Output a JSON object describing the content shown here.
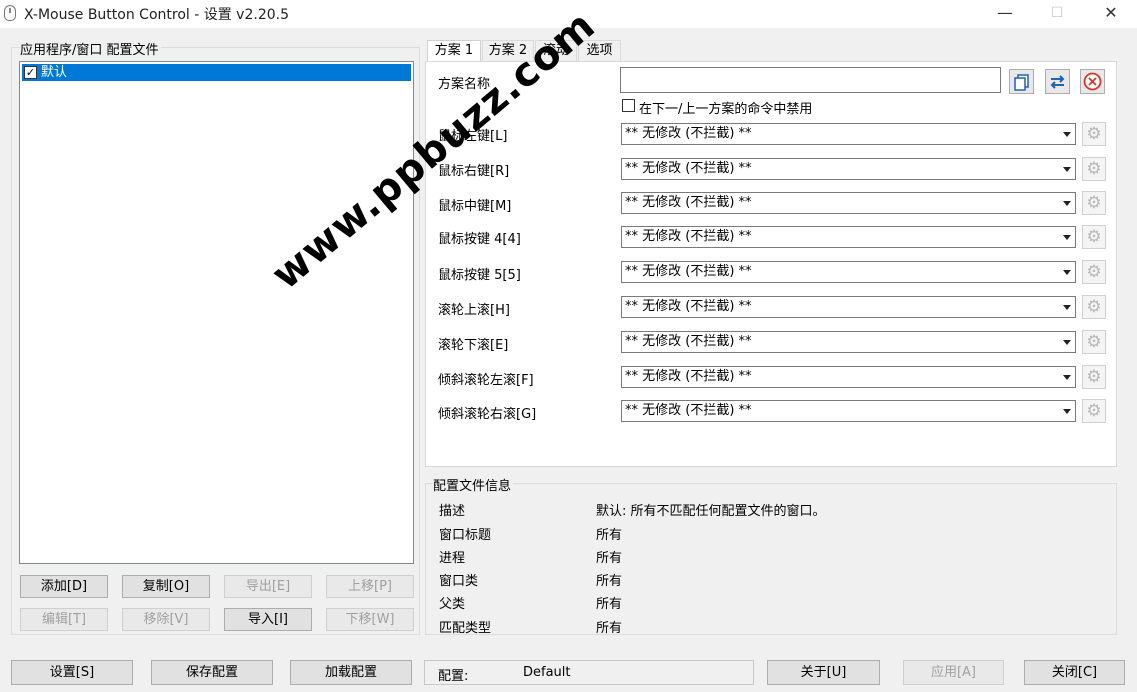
{
  "window": {
    "title": "X-Mouse Button Control - 设置 v2.20.5",
    "minimize_icon": "—",
    "maximize_icon": "☐",
    "close_icon": "✕"
  },
  "left_panel": {
    "group_label": "应用程序/窗口 配置文件",
    "list_items": [
      {
        "label": "默认",
        "checked": true,
        "check_glyph": "✓"
      }
    ],
    "buttons_row1": [
      {
        "label": "添加[D]",
        "enabled": true
      },
      {
        "label": "复制[O]",
        "enabled": true
      },
      {
        "label": "导出[E]",
        "enabled": false
      },
      {
        "label": "上移[P]",
        "enabled": false
      }
    ],
    "buttons_row2": [
      {
        "label": "编辑[T]",
        "enabled": false
      },
      {
        "label": "移除[V]",
        "enabled": false
      },
      {
        "label": "导入[I]",
        "enabled": true
      },
      {
        "label": "下移[W]",
        "enabled": false
      }
    ]
  },
  "tabs": [
    {
      "label": "方案 1",
      "active": true
    },
    {
      "label": "方案 2",
      "active": false
    },
    {
      "label": "滚动",
      "active": false
    },
    {
      "label": "选项",
      "active": false
    }
  ],
  "scheme": {
    "name_label": "方案名称",
    "name_value": "",
    "disable_checkbox_label": "在下一/上一方案的命令中禁用",
    "disable_checked": false,
    "icon_buttons": [
      "copy-icon",
      "swap-icon",
      "clear-icon"
    ],
    "gear_glyph": "⚙",
    "rows": [
      {
        "label": "鼠标左键[L]",
        "value": "** 无修改 (不拦截) **"
      },
      {
        "label": "鼠标右键[R]",
        "value": "** 无修改 (不拦截) **"
      },
      {
        "label": "鼠标中键[M]",
        "value": "** 无修改 (不拦截) **"
      },
      {
        "label": "鼠标按键 4[4]",
        "value": "** 无修改 (不拦截) **"
      },
      {
        "label": "鼠标按键 5[5]",
        "value": "** 无修改 (不拦截) **"
      },
      {
        "label": "滚轮上滚[H]",
        "value": "** 无修改 (不拦截) **"
      },
      {
        "label": "滚轮下滚[E]",
        "value": "** 无修改 (不拦截) **"
      },
      {
        "label": "倾斜滚轮左滚[F]",
        "value": "** 无修改 (不拦截) **"
      },
      {
        "label": "倾斜滚轮右滚[G]",
        "value": "** 无修改 (不拦截) **"
      }
    ]
  },
  "profile_info": {
    "group_label": "配置文件信息",
    "rows": [
      {
        "key": "描述",
        "value": "默认: 所有不匹配任何配置文件的窗口。"
      },
      {
        "key": "窗口标题",
        "value": "所有"
      },
      {
        "key": "进程",
        "value": "所有"
      },
      {
        "key": "窗口类",
        "value": "所有"
      },
      {
        "key": "父类",
        "value": "所有"
      },
      {
        "key": "匹配类型",
        "value": "所有"
      }
    ]
  },
  "watermark": "www.ppbuzz.com",
  "bottom": {
    "settings_button": "设置[S]",
    "save_button": "保存配置",
    "load_button": "加载配置",
    "config_label": "配置:",
    "config_value": "Default",
    "about_button": "关于[U]",
    "apply_button": "应用[A]",
    "close_button": "关闭[C]"
  },
  "colors": {
    "selection": "#0078d7",
    "window_bg": "#f0f0f0",
    "swap_icon": "#1e5fbf",
    "clear_icon": "#e0322d"
  }
}
